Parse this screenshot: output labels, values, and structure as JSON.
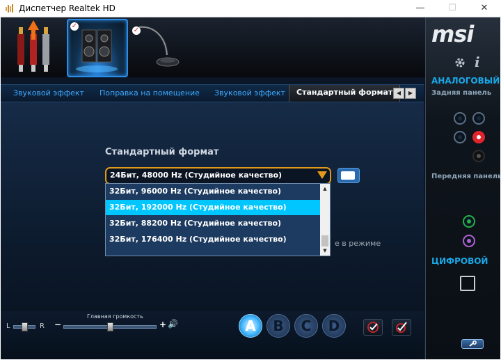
{
  "window": {
    "title": "Диспетчер Realtek HD",
    "minimize_icon": "minimize-icon",
    "maximize_icon": "maximize-icon",
    "close_icon": "close-icon",
    "minimize_glyph": "—",
    "maximize_glyph": "☐",
    "close_glyph": "✕"
  },
  "devices": [
    {
      "name": "line-in",
      "icon": "rca-jacks-icon",
      "selected": false,
      "checked": false
    },
    {
      "name": "speakers",
      "icon": "speakers-icon",
      "selected": true,
      "checked": true
    },
    {
      "name": "microphone",
      "icon": "microphone-icon",
      "selected": false,
      "checked": true
    }
  ],
  "tabs": [
    {
      "label": "Звуковой эффект",
      "active": false
    },
    {
      "label": "Поправка на помещение",
      "active": false
    },
    {
      "label": "Звуковой эффект",
      "active": false
    },
    {
      "label": "Стандартный формат",
      "active": true
    }
  ],
  "tab_scroll": {
    "left": "◀",
    "right": "▶"
  },
  "format": {
    "title": "Стандартный формат",
    "selected": "24Бит, 48000 Hz (Студийное качество)",
    "options": [
      "32Бит, 96000 Hz (Студийное качество)",
      "32Бит, 192000 Hz (Студийное качество)",
      "32Бит, 88200 Hz (Студийное качество)",
      "32Бит, 176400 Hz (Студийное качество)"
    ],
    "highlighted_index": 1,
    "partially_hidden_text": "е в режиме",
    "scroll_up": "▲",
    "scroll_down": "▼"
  },
  "volume": {
    "label": "Главная громкость",
    "left": "L",
    "right": "R",
    "minus": "−",
    "plus": "+",
    "balance": 0.5,
    "level": 0.5,
    "speaker_glyph": "🔊"
  },
  "profiles": [
    {
      "letter": "A",
      "active": true
    },
    {
      "letter": "B",
      "active": false
    },
    {
      "letter": "C",
      "active": false
    },
    {
      "letter": "D",
      "active": false
    }
  ],
  "sidebar": {
    "logo": "msi",
    "analog": "АНАЛОГОВЫЙ",
    "rear_panel": "Задняя панель",
    "front_panel": "Передняя панель",
    "digital": "ЦИФРОВОЙ",
    "info_glyph": "i"
  },
  "colors": {
    "accent_blue": "#3fa9ff",
    "highlight": "#00c6ff",
    "combo_border": "#e09a1c",
    "sidebar_heading": "#19a8e8",
    "jack_red": "#e0242c",
    "jack_green": "#21b24a",
    "jack_pink": "#b060d0"
  }
}
